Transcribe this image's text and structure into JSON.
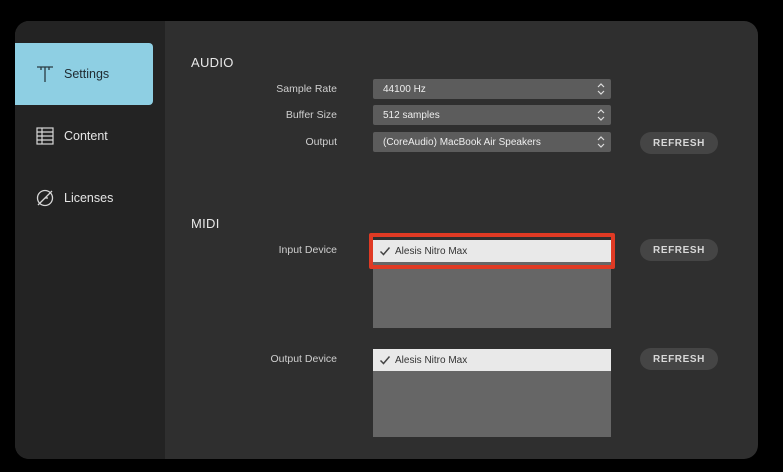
{
  "sidebar": {
    "items": [
      {
        "label": "Settings",
        "icon": "tuning-fork-icon",
        "active": true
      },
      {
        "label": "Content",
        "icon": "list-icon",
        "active": false
      },
      {
        "label": "Licenses",
        "icon": "license-icon",
        "active": false
      }
    ]
  },
  "audio": {
    "title": "AUDIO",
    "sample_rate": {
      "label": "Sample Rate",
      "value": "44100 Hz"
    },
    "buffer_size": {
      "label": "Buffer Size",
      "value": "512 samples"
    },
    "output": {
      "label": "Output",
      "value": "(CoreAudio) MacBook Air Speakers",
      "refresh_label": "REFRESH"
    }
  },
  "midi": {
    "title": "MIDI",
    "input_device": {
      "label": "Input Device",
      "items": [
        "Alesis Nitro Max"
      ],
      "refresh_label": "REFRESH"
    },
    "output_device": {
      "label": "Output Device",
      "items": [
        "Alesis Nitro Max"
      ],
      "refresh_label": "REFRESH"
    }
  },
  "colors": {
    "accent": "#8ecfe3",
    "highlight": "#e03a24",
    "panel": "#2f2f2f",
    "sidebar": "#232323"
  }
}
